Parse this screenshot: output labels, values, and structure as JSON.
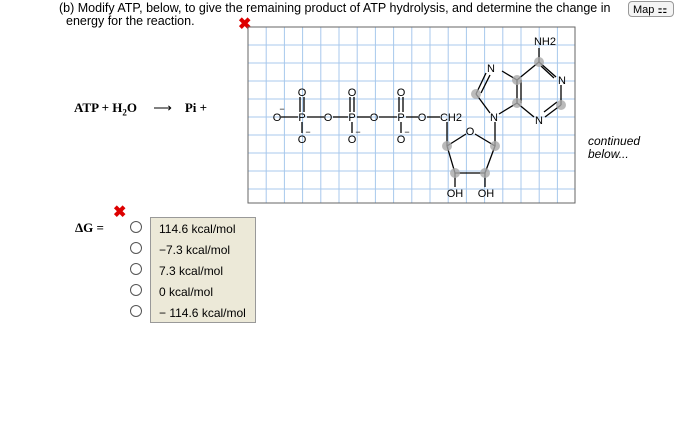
{
  "question": {
    "line1": "(b) Modify ATP, below, to give the remaining product of ATP hydrolysis, and determine the change in",
    "line2": "energy for the reaction."
  },
  "map_button": "Map",
  "equation": {
    "left": "ATP + H",
    "sub": "2",
    "o": "O",
    "arrow": "⟶",
    "right": "Pi +"
  },
  "delta_g_label": "ΔG =",
  "continued": {
    "line1": "continued",
    "line2": "below..."
  },
  "options": [
    "114.6 kcal/mol",
    "−7.3 kcal/mol",
    "7.3 kcal/mol",
    "0 kcal/mol",
    "− 114.6 kcal/mol"
  ],
  "molecule": {
    "nh2": "NH2",
    "ch2": "CH2",
    "oh": "OH"
  },
  "colors": {
    "grid": "#a8c8ec",
    "error": "#d00000"
  }
}
